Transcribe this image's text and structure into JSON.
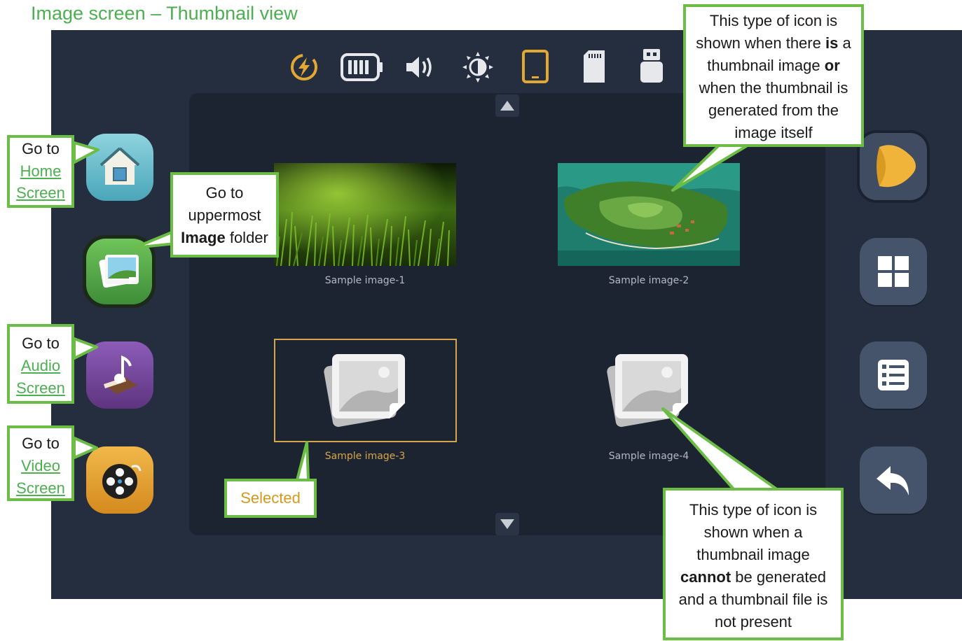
{
  "page_title": "Image screen – Thumbnail view",
  "status_icons": [
    "lightning-icon",
    "battery-icon",
    "volume-icon",
    "brightness-icon",
    "tablet-icon",
    "sd-card-icon",
    "usb-drive-icon"
  ],
  "colors": {
    "accent": "#d6a64a",
    "callout_border": "#6cbd45",
    "link": "#4caf50",
    "panel": "#1c2432",
    "device": "#252e3e"
  },
  "thumbnails": [
    {
      "label": "Sample image-1",
      "kind": "photo-grass",
      "selected": false
    },
    {
      "label": "Sample image-2",
      "kind": "photo-island",
      "selected": false
    },
    {
      "label": "Sample image-3",
      "kind": "placeholder",
      "selected": true
    },
    {
      "label": "Sample image-4",
      "kind": "placeholder",
      "selected": false
    }
  ],
  "left_nav": [
    "home-button",
    "image-button",
    "audio-button",
    "video-button"
  ],
  "right_nav": [
    "play-button",
    "grid-view-button",
    "list-view-button",
    "back-button"
  ],
  "callouts": {
    "home": {
      "line1": "Go to",
      "link1": "Home",
      "link2": "Screen"
    },
    "image": {
      "line1": "Go to",
      "line2": "uppermost",
      "bold": "Image",
      "rest": " folder"
    },
    "audio": {
      "line1": "Go to",
      "link1": "Audio",
      "link2": "Screen"
    },
    "video": {
      "line1": "Go to",
      "link1": "Video",
      "link2": "Screen"
    },
    "selected": "Selected",
    "thumb_icon": {
      "t1": "This type of icon is",
      "t2a": "shown when there ",
      "t2b": "is",
      "t2c": " a",
      "t3a": "thumbnail image ",
      "t3b": "or",
      "t4": "when the thumbnail is",
      "t5": "generated from the",
      "t6": "image itself"
    },
    "placeholder_icon": {
      "t1": "This type of icon is",
      "t2": "shown when a",
      "t3": "thumbnail image",
      "t4a": "cannot",
      "t4b": " be generated",
      "t5": "and a thumbnail file is",
      "t6": "not present"
    }
  }
}
